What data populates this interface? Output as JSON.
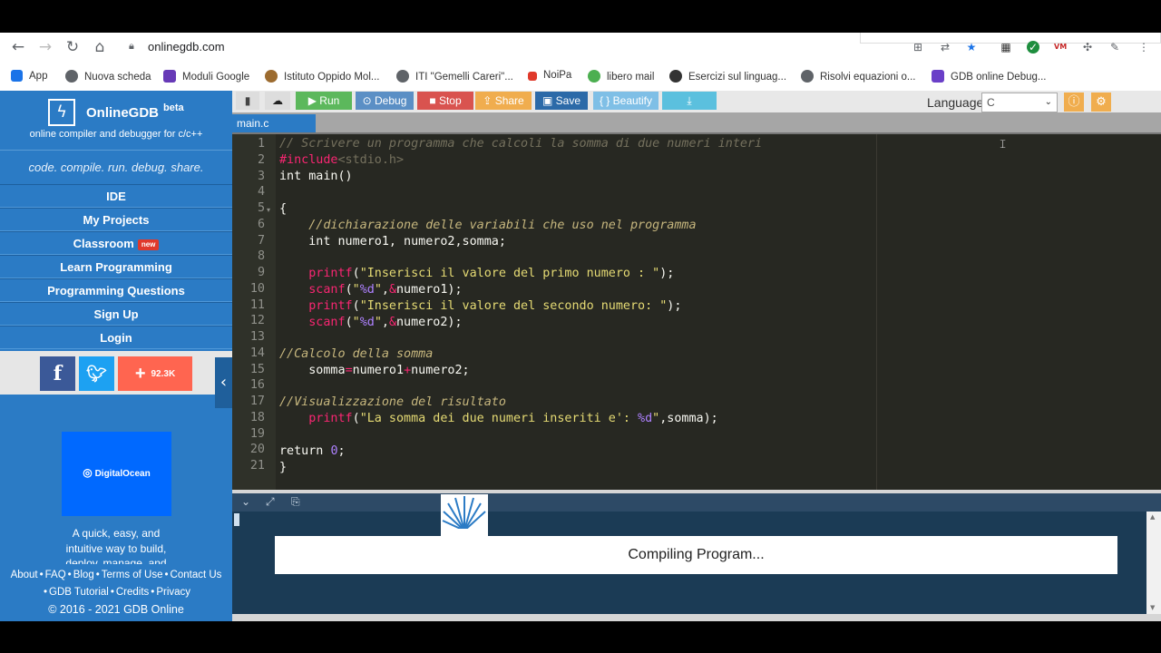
{
  "browser": {
    "url": "onlinegdb.com",
    "bookmarks": [
      {
        "label": "App",
        "color": "#1a73e8"
      },
      {
        "label": "Nuova scheda",
        "color": "#5f6368"
      },
      {
        "label": "Moduli Google",
        "color": "#673ab7"
      },
      {
        "label": "Istituto Oppido Mol...",
        "color": "#9c6b2f"
      },
      {
        "label": "ITI \"Gemelli Careri\"...",
        "color": "#5f6368"
      },
      {
        "label": "NoiPa",
        "color": "#e0392b"
      },
      {
        "label": "libero mail",
        "color": "#4caf50"
      },
      {
        "label": "Esercizi sul linguag...",
        "color": "#333333"
      },
      {
        "label": "Risolvi equazioni o...",
        "color": "#5f6368"
      },
      {
        "label": "GDB online Debug...",
        "color": "#6a3fc8"
      }
    ]
  },
  "brand": {
    "name": "OnlineGDB",
    "beta": "beta",
    "tagline": "online compiler and debugger for c/c++",
    "motto": "code. compile. run. debug. share."
  },
  "menu": {
    "ide": "IDE",
    "my_projects": "My Projects",
    "classroom": "Classroom",
    "classroom_badge": "new",
    "learn": "Learn Programming",
    "questions": "Programming Questions",
    "signup": "Sign Up",
    "login": "Login"
  },
  "social": {
    "facebook": "f",
    "twitter": "t",
    "share_count": "92.3K"
  },
  "ad": {
    "logo": "DigitalOcean",
    "text": "A quick, easy, and intuitive way to build, deploy, manage, and"
  },
  "footer": {
    "about": "About",
    "faq": "FAQ",
    "blog": "Blog",
    "terms": "Terms of Use",
    "contact": "Contact Us",
    "tutorial": "GDB Tutorial",
    "credits": "Credits",
    "privacy": "Privacy",
    "copyright": "© 2016 - 2021 GDB Online"
  },
  "toolbar": {
    "run": "Run",
    "debug": "Debug",
    "stop": "Stop",
    "share": "Share",
    "save": "Save",
    "beautify": "{ } Beautify",
    "language_label": "Language",
    "language_value": "C",
    "colors": {
      "run": "#5cb85c",
      "debug": "#5b8fc5",
      "stop": "#d9534f",
      "share": "#f0ad4e",
      "save": "#2c6aa8",
      "beautify": "#7fbfe6",
      "download": "#5bc0de"
    }
  },
  "file_tab": "main.c",
  "editor": {
    "line_numbers": [
      "1",
      "2",
      "3",
      "4",
      "5",
      "6",
      "7",
      "8",
      "9",
      "10",
      "11",
      "12",
      "13",
      "14",
      "15",
      "16",
      "17",
      "18",
      "19",
      "20",
      "21"
    ]
  },
  "output": {
    "status": "Compiling Program..."
  }
}
